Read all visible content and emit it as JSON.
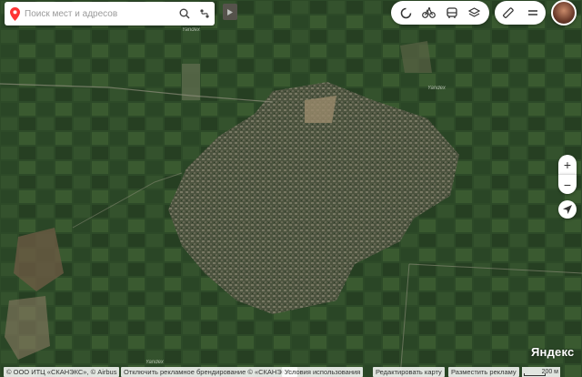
{
  "search": {
    "placeholder": "Поиск мест и адресов"
  },
  "map_labels": {
    "place_1": "Yandex",
    "place_2": "Yandex",
    "place_3": "Yandex"
  },
  "layers": {
    "items": [
      "panorama-icon",
      "bike-route-icon",
      "transit-icon",
      "layers-icon"
    ]
  },
  "tools": {
    "items": [
      "ruler-icon",
      "menu-icon"
    ]
  },
  "zoom": {
    "in": "+",
    "out": "−"
  },
  "logo": "Яндекс",
  "footer": {
    "copyright": "© ООО ИТЦ «СКАНЭКС», © Airbus",
    "disable_ad": "Отключить рекламное брендирование",
    "scanex": "© «СКАНЭКС»",
    "terms": "Условия использования",
    "edit_map": "Редактировать карту",
    "place_ad": "Разместить рекламу",
    "scale": "200 м"
  },
  "colors": {
    "accent": "#ff3333",
    "panel": "#ffffff"
  }
}
